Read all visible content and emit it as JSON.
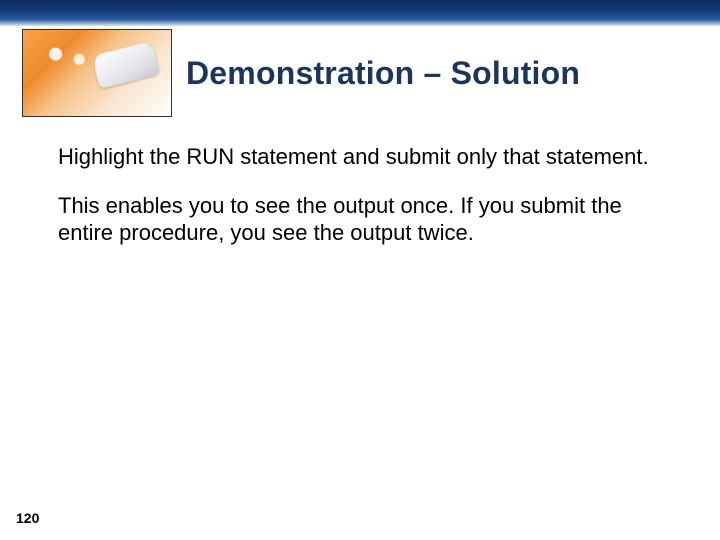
{
  "slide": {
    "title": "Demonstration – Solution",
    "paragraphs": [
      "Highlight the RUN statement and submit only that statement.",
      "This enables you to see the output once. If you submit the entire procedure, you see the output twice."
    ],
    "page_number": "120"
  }
}
